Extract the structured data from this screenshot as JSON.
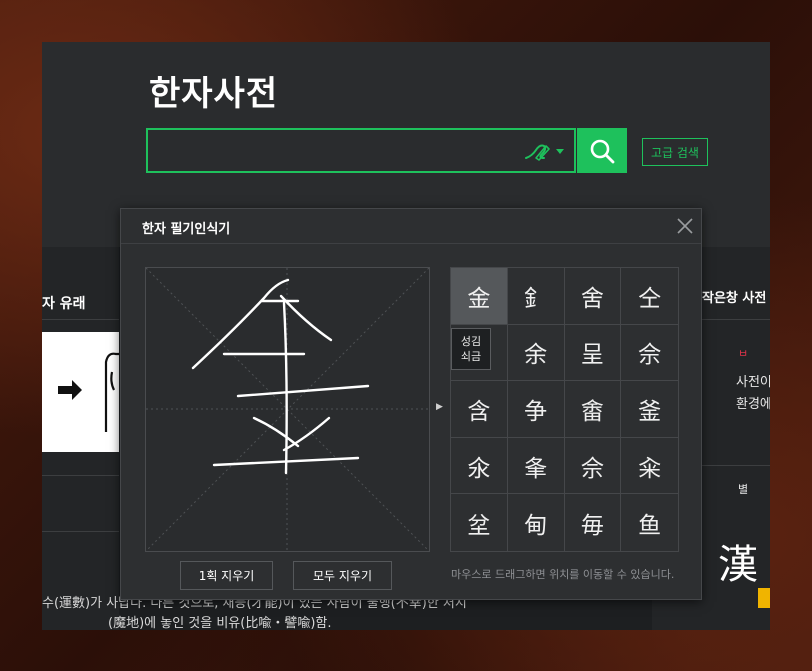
{
  "site": {
    "title": "한자사전",
    "search": {
      "value": "",
      "placeholder": ""
    },
    "advanced_search_label": "고급 검색"
  },
  "colors": {
    "accent": "#1ec15c",
    "background": "#1d1f21",
    "header": "#2a2c2e",
    "highlight": "#f0b400"
  },
  "icons": {
    "search": "search-icon",
    "handwrite": "handwriting-pen-icon",
    "dropdown": "caret-down-icon",
    "close": "close-icon",
    "arrow": "arrow-right-icon"
  },
  "left_panel": {
    "heading": "자 유래"
  },
  "right_panel": {
    "line1": "작은창 사전",
    "line2": "ㅂ",
    "line3": "사전이 새롭",
    "line4": "환경에 따른",
    "line5": "별",
    "hanja": "漢"
  },
  "body_text": {
    "line1": "수(運數)가 사납다. 다른 것으로, 재능(才能)이 있는 사람이 불행(不幸)한 처지",
    "line2": "(魔地)에 놓인 것을 비유(比喩・譬喩)함."
  },
  "handwriting_popup": {
    "title": "한자 필기인식기",
    "candidates": [
      "金",
      "釒",
      "舍",
      "仝",
      "",
      "余",
      "呈",
      "佘",
      "含",
      "争",
      "畬",
      "釜",
      "氽",
      "夆",
      "佘",
      "籴",
      "坌",
      "甸",
      "毎",
      "鱼"
    ],
    "tooltip": {
      "line1": "성김",
      "line2": "쇠금"
    },
    "undo_one_label": "1획 지우기",
    "clear_all_label": "모두 지우기",
    "hint": "마우스로 드래그하면 위치를 이동할 수 있습니다."
  }
}
